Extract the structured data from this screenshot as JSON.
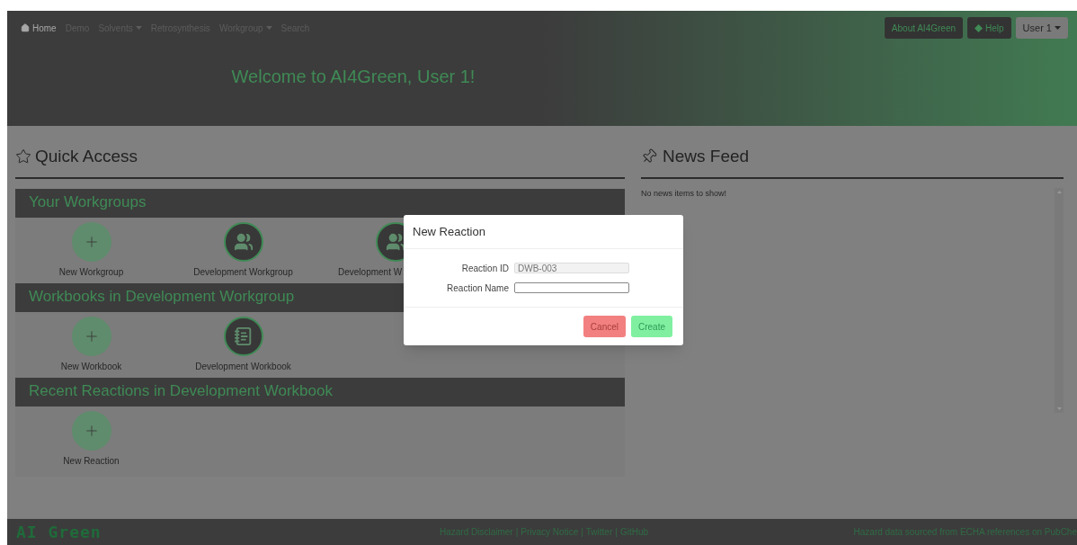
{
  "nav": {
    "items": [
      {
        "label": "Home",
        "kind": "home",
        "selected": true
      },
      {
        "label": "Demo",
        "kind": "link",
        "selected": false
      },
      {
        "label": "Solvents",
        "kind": "dropdown",
        "selected": false
      },
      {
        "label": "Retrosynthesis",
        "kind": "link",
        "selected": false
      },
      {
        "label": "Workgroup",
        "kind": "dropdown",
        "selected": false
      },
      {
        "label": "Search",
        "kind": "link",
        "selected": false
      }
    ],
    "buttons": [
      {
        "label": "About AI4Green",
        "kind": "about"
      },
      {
        "label": "Help",
        "kind": "help"
      },
      {
        "label": "User 1",
        "kind": "user"
      }
    ]
  },
  "welcome": "Welcome to AI4Green, User 1!",
  "quick_access": {
    "title": "Quick Access",
    "sections": [
      {
        "title": "Your Workgroups",
        "items": [
          {
            "label": "New Workgroup",
            "kind": "add"
          },
          {
            "label": "Development Workgroup",
            "kind": "workgroup"
          },
          {
            "label": "Development W",
            "kind": "workgroup",
            "covered": true
          }
        ]
      },
      {
        "title": "Workbooks in Development Workgroup",
        "items": [
          {
            "label": "New Workbook",
            "kind": "add"
          },
          {
            "label": "Development Workbook",
            "kind": "workbook"
          }
        ]
      },
      {
        "title": "Recent Reactions in Development Workbook",
        "items": [
          {
            "label": "New Reaction",
            "kind": "add"
          }
        ]
      }
    ]
  },
  "news_feed": {
    "title": "News Feed",
    "message": "No news items to show!"
  },
  "modal": {
    "title": "New Reaction",
    "fields": [
      {
        "label": "Reaction ID",
        "value": "DWB-003",
        "disabled": true
      },
      {
        "label": "Reaction Name",
        "disabled": false
      }
    ],
    "buttons": [
      {
        "label": "Cancel",
        "kind": "cancel"
      },
      {
        "label": "Create",
        "kind": "create"
      }
    ]
  },
  "footer": {
    "logo": "AI Green",
    "links": [
      {
        "label": "Hazard Disclaimer",
        "kind": "link"
      },
      {
        "label": "|",
        "kind": "separator"
      },
      {
        "label": "Privacy Notice",
        "kind": "link"
      },
      {
        "label": "|",
        "kind": "separator"
      },
      {
        "label": "Twitter",
        "kind": "link"
      },
      {
        "label": "|",
        "kind": "separator"
      },
      {
        "label": "GitHub",
        "kind": "link"
      }
    ],
    "source": "Hazard data sourced from ECHA references on PubChe"
  }
}
